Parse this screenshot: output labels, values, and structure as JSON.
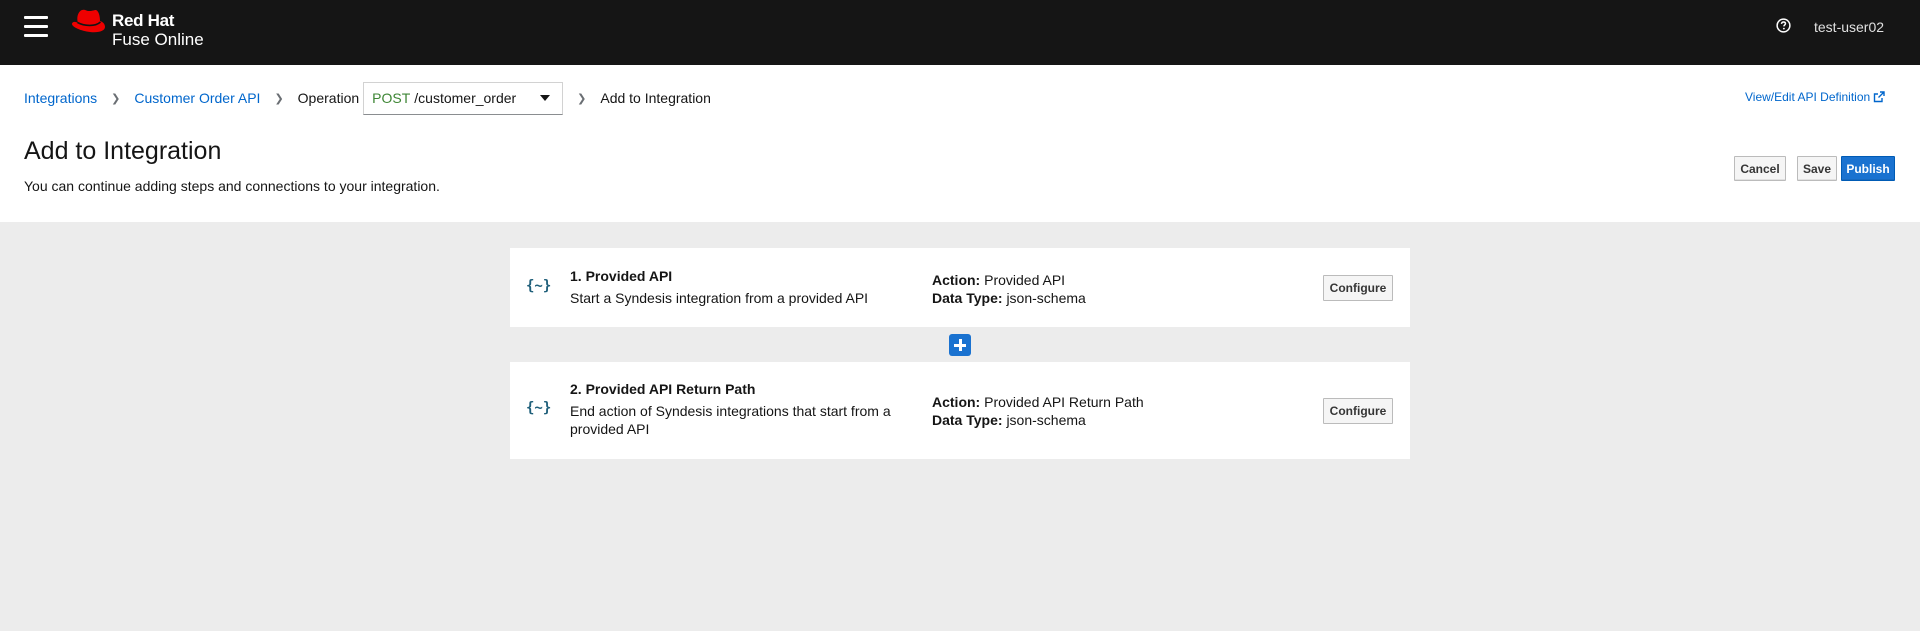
{
  "app": {
    "brand_line1": "Red Hat",
    "brand_line2": "Fuse Online",
    "username": "test-user02"
  },
  "breadcrumb": {
    "integrations": "Integrations",
    "api": "Customer Order API",
    "operation_label": "Operation",
    "operation_method": "POST",
    "operation_path": "/customer_order",
    "current": "Add to Integration"
  },
  "header": {
    "view_edit_link": "View/Edit API Definition",
    "title": "Add to Integration",
    "subtitle": "You can continue adding steps and connections to your integration.",
    "cancel_label": "Cancel",
    "save_label": "Save",
    "publish_label": "Publish"
  },
  "steps": [
    {
      "title": "1. Provided API",
      "description": "Start a Syndesis integration from a provided API",
      "action_label": "Action:",
      "action_value": "Provided API",
      "datatype_label": "Data Type:",
      "datatype_value": "json-schema",
      "configure_label": "Configure"
    },
    {
      "title": "2. Provided API Return Path",
      "description": "End action of Syndesis integrations that start from a provided API",
      "action_label": "Action:",
      "action_value": "Provided API Return Path",
      "datatype_label": "Data Type:",
      "datatype_value": "json-schema",
      "configure_label": "Configure"
    }
  ],
  "icons": {
    "menu": "hamburger-menu-icon",
    "logo": "red-hat-fedora-logo",
    "help": "help-circle-icon",
    "external": "external-link-icon",
    "step": "curly-braces-api-icon",
    "add": "plus-icon"
  },
  "colors": {
    "topbar": "#151515",
    "link": "#0066cc",
    "primary": "#1a72d0",
    "post_method": "#3e8635",
    "logo_red": "#ee0000"
  }
}
